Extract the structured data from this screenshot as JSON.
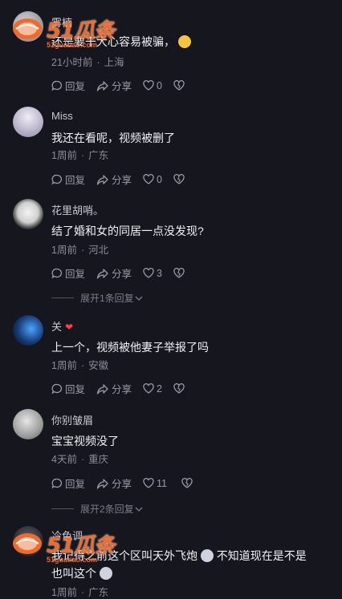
{
  "watermark": {
    "brand": "51瓜条",
    "url": "51guatiao.com"
  },
  "comments": [
    {
      "name": "雾楠",
      "text": "还是要干大心容易被骗，",
      "time": "21小时前",
      "location": "上海",
      "reply_label": "回复",
      "share_label": "分享",
      "likes": "0"
    },
    {
      "name": "Miss",
      "text": "我还在看呢，视频被删了",
      "time": "1周前",
      "location": "广东",
      "reply_label": "回复",
      "share_label": "分享",
      "likes": "0"
    },
    {
      "name": "花里胡哨。",
      "text": "结了婚和女的同居一点没发现?",
      "time": "1周前",
      "location": "河北",
      "reply_label": "回复",
      "share_label": "分享",
      "likes": "3",
      "expand": "展开1条回复"
    },
    {
      "name": "关",
      "text": "上一个，视频被他妻子举报了吗",
      "time": "1周前",
      "location": "安徽",
      "reply_label": "回复",
      "share_label": "分享",
      "likes": "2"
    },
    {
      "name": "你别皱眉",
      "text": "宝宝视频没了",
      "time": "4天前",
      "location": "重庆",
      "reply_label": "回复",
      "share_label": "分享",
      "likes": "11",
      "expand": "展开2条回复"
    },
    {
      "name": "冷色调",
      "text": "我记得之前这个区叫天外飞炮",
      "text2": "不知道现在是不是",
      "text3": "也叫这个",
      "time": "1周前",
      "location": "广东"
    }
  ]
}
